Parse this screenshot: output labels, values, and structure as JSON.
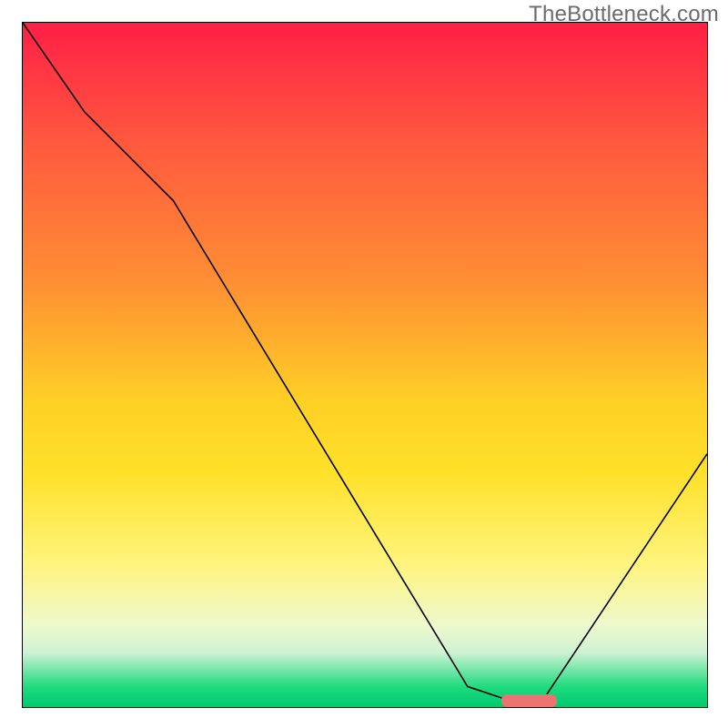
{
  "watermark": "TheBottleneck.com",
  "palette": {
    "marker": "#ec7373",
    "curve": "#000000"
  },
  "chart_data": {
    "type": "line",
    "title": "",
    "xlabel": "",
    "ylabel": "",
    "xlim": [
      0,
      100
    ],
    "ylim": [
      0,
      100
    ],
    "series": [
      {
        "name": "bottleneck_curve",
        "x": [
          0,
          9,
          22,
          65,
          71,
          76,
          100
        ],
        "y": [
          100,
          87,
          74,
          3,
          1,
          1,
          37
        ]
      }
    ],
    "optimal_region": {
      "x_start": 70,
      "x_end": 78
    },
    "background_gradient_stops": [
      {
        "pos": 0,
        "color": "#ff1f46"
      },
      {
        "pos": 18,
        "color": "#ff5a3e"
      },
      {
        "pos": 38,
        "color": "#ff8f34"
      },
      {
        "pos": 55,
        "color": "#ffcf26"
      },
      {
        "pos": 66,
        "color": "#ffe12a"
      },
      {
        "pos": 79,
        "color": "#fff47e"
      },
      {
        "pos": 88,
        "color": "#eef9cd"
      },
      {
        "pos": 92,
        "color": "#cff2d3"
      },
      {
        "pos": 97,
        "color": "#20db80"
      },
      {
        "pos": 100,
        "color": "#00c96e"
      }
    ]
  }
}
